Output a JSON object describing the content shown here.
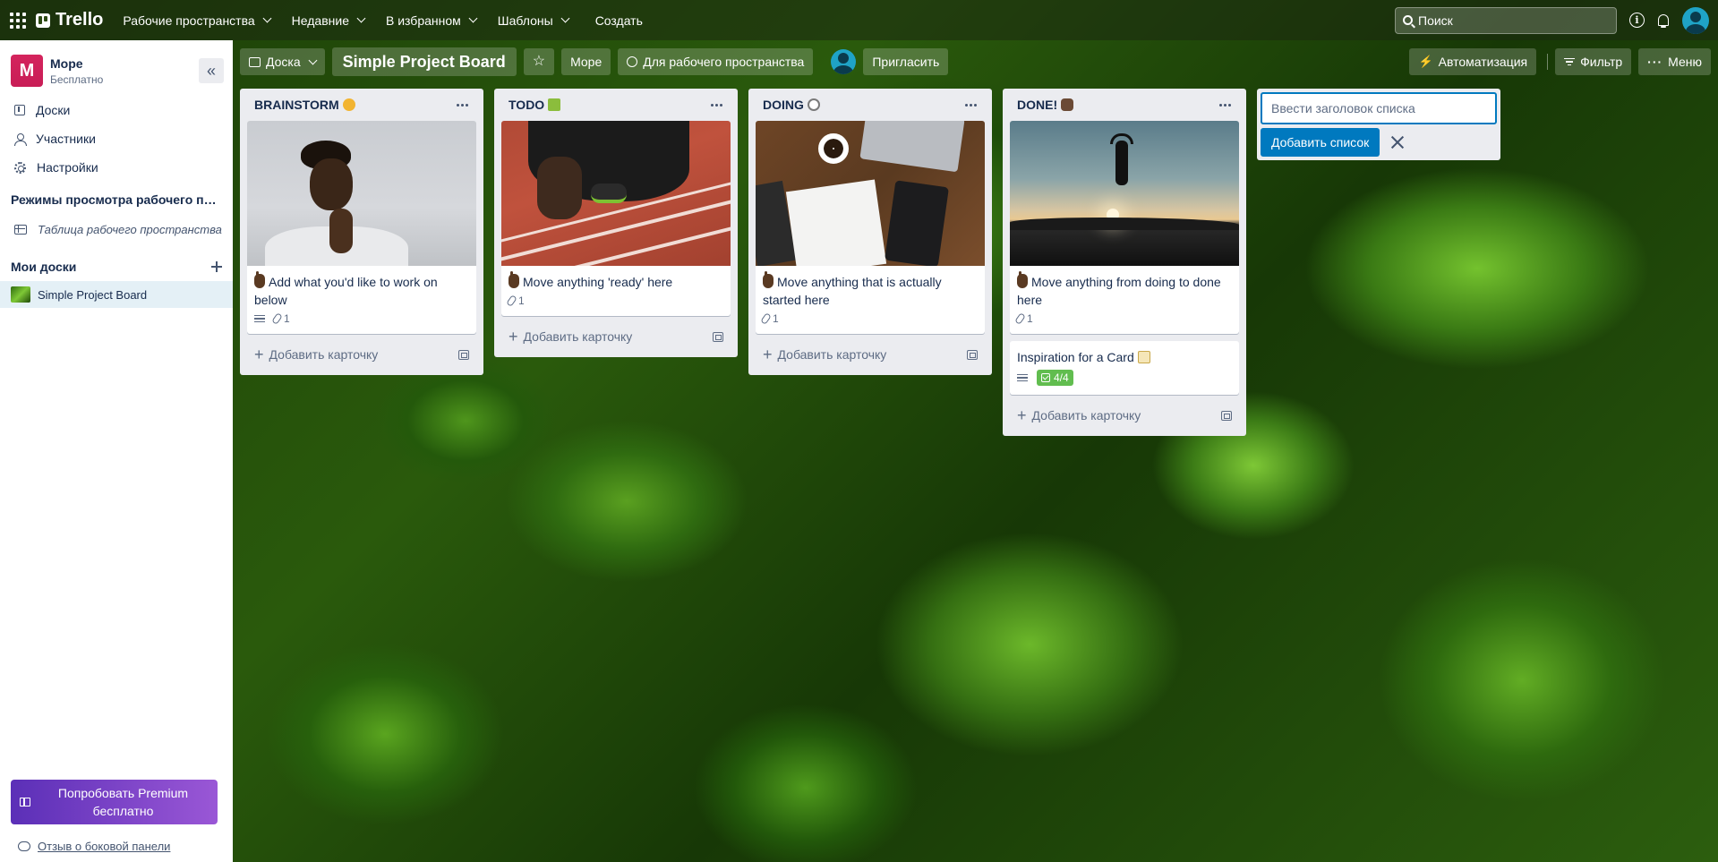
{
  "nav": {
    "logo": "Trello",
    "menus": [
      "Рабочие пространства",
      "Недавние",
      "В избранном",
      "Шаблоны"
    ],
    "create": "Создать",
    "search_placeholder": "Поиск"
  },
  "sidebar": {
    "workspace_initial": "M",
    "workspace_name": "Море",
    "workspace_plan": "Бесплатно",
    "items": [
      {
        "label": "Доски",
        "icon": "board-icon"
      },
      {
        "label": "Участники",
        "icon": "members-icon"
      },
      {
        "label": "Настройки",
        "icon": "settings-icon"
      }
    ],
    "views_section": "Режимы просмотра рабочего пространства",
    "views_item": "Таблица рабочего пространства",
    "my_boards": "Мои доски",
    "boards": [
      "Simple Project Board"
    ],
    "premium": "Попробовать Premium бесплатно",
    "feedback": "Отзыв о боковой панели"
  },
  "board_header": {
    "view": "Доска",
    "title": "Simple Project Board",
    "workspace": "Море",
    "visibility": "Для рабочего пространства",
    "invite": "Пригласить",
    "automation": "Автоматизация",
    "filter": "Фильтр",
    "menu": "Меню"
  },
  "lists": [
    {
      "title": "BRAINSTORM",
      "emoji_color": "#f2b431",
      "cards": [
        {
          "title": "Add what you'd like to work on below",
          "description": true,
          "attachments": "1",
          "cover": "woman"
        }
      ],
      "add_card": "Добавить карточку"
    },
    {
      "title": "TODO",
      "emoji_color": "#8bbd3c",
      "cards": [
        {
          "title": "Move anything 'ready' here",
          "description": false,
          "attachments": "1",
          "cover": "track"
        }
      ],
      "add_card": "Добавить карточку"
    },
    {
      "title": "DOING",
      "emoji_color": "#7a7a7a",
      "cards": [
        {
          "title": "Move anything that is actually started here",
          "description": false,
          "attachments": "1",
          "cover": "desk"
        }
      ],
      "add_card": "Добавить карточку"
    },
    {
      "title": "DONE!",
      "emoji_color": "#6b4a35",
      "cards": [
        {
          "title": "Move anything from doing to done here",
          "description": false,
          "attachments": "1",
          "cover": "sunset"
        },
        {
          "title": "Inspiration for a Card",
          "description": true,
          "checklist": "4/4"
        }
      ],
      "add_card": "Добавить карточку"
    }
  ],
  "add_list": {
    "placeholder": "Ввести заголовок списка",
    "button": "Добавить список"
  },
  "colors": {
    "accent": "#0079bf",
    "checklist_done": "#61bd4f",
    "workspace_logo": "#c81d56",
    "premium_start": "#5b2fb7",
    "premium_end": "#9a57d6"
  }
}
